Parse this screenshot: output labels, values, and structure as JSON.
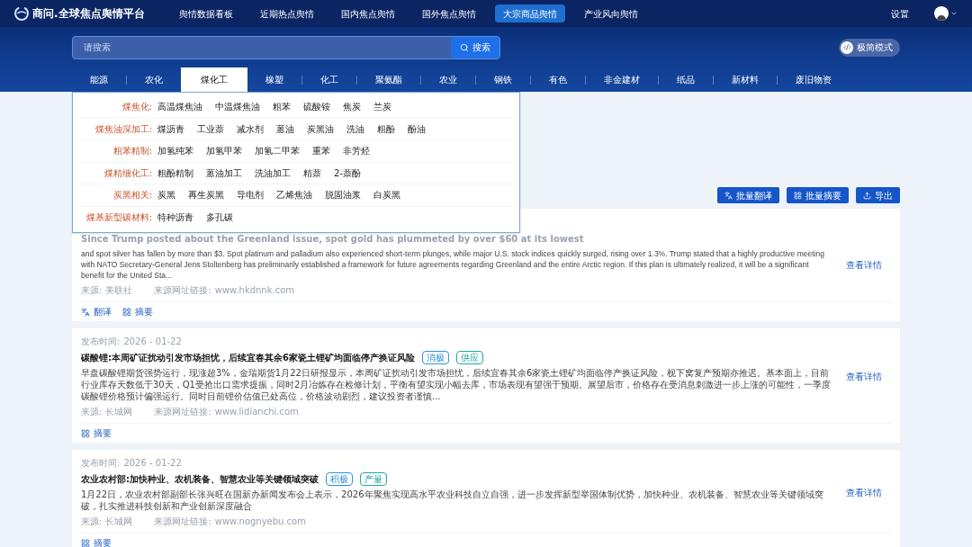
{
  "brand": {
    "name": "商问.全球焦点舆情平台"
  },
  "nav": [
    {
      "label": "舆情数据看板",
      "selected": false
    },
    {
      "label": "近期热点舆情",
      "selected": false
    },
    {
      "label": "国内焦点舆情",
      "selected": false
    },
    {
      "label": "国外焦点舆情",
      "selected": false
    },
    {
      "label": "大宗商品舆情",
      "selected": true
    },
    {
      "label": "产业风向舆情",
      "selected": false
    }
  ],
  "settings": "设置",
  "search": {
    "placeholder": "请搜索",
    "button": "搜索"
  },
  "mode_toggle": "极简模式",
  "categories": [
    {
      "label": "能源",
      "selected": false
    },
    {
      "label": "农化",
      "selected": false
    },
    {
      "label": "煤化工",
      "selected": true
    },
    {
      "label": "橡塑",
      "selected": false
    },
    {
      "label": "化工",
      "selected": false
    },
    {
      "label": "聚氨酯",
      "selected": false
    },
    {
      "label": "农业",
      "selected": false
    },
    {
      "label": "钢铁",
      "selected": false
    },
    {
      "label": "有色",
      "selected": false
    },
    {
      "label": "非金建材",
      "selected": false
    },
    {
      "label": "纸品",
      "selected": false
    },
    {
      "label": "新材料",
      "selected": false
    },
    {
      "label": "废旧物资",
      "selected": false
    }
  ],
  "dropdown": [
    {
      "label": "煤焦化:",
      "items": [
        "高温煤焦油",
        "中温煤焦油",
        "粗苯",
        "硫酸铵",
        "焦炭",
        "兰炭"
      ]
    },
    {
      "label": "煤焦油深加工:",
      "items": [
        "煤沥青",
        "工业萘",
        "减水剂",
        "蒽油",
        "炭黑油",
        "洗油",
        "粗酚",
        "酚油"
      ]
    },
    {
      "label": "粗苯精制:",
      "items": [
        "加氢纯苯",
        "加氢甲苯",
        "加氢二甲苯",
        "重苯",
        "非芳烃"
      ]
    },
    {
      "label": "煤精细化工:",
      "items": [
        "粗酚精制",
        "蒽油加工",
        "洗油加工",
        "精萘",
        "2-萘酚"
      ]
    },
    {
      "label": "炭黑相关:",
      "items": [
        "炭黑",
        "再生炭黑",
        "导电剂",
        "乙烯焦油",
        "脱固油浆",
        "白炭黑"
      ]
    },
    {
      "label": "煤基新型碳材料:",
      "items": [
        "特种沥青",
        "多孔碳"
      ]
    }
  ],
  "actions": [
    {
      "label": "批量翻译",
      "kind": "translate"
    },
    {
      "label": "批量摘要",
      "kind": "summary"
    },
    {
      "label": "导出",
      "kind": "export"
    }
  ],
  "articles": [
    {
      "title": "Since Trump posted about the Greenland issue, spot gold has plummeted by over $60 at its lowest",
      "body": "and spot silver has fallen by more than $3. Spot platinum and palladium also experienced short-term plunges, while major U.S. stock indices quickly surged, rising over 1.3%. Trump stated that a highly productive meeting with NATO Secretary-General Jens Stoltenberg has preliminarily established a framework for future agreements regarding Greenland and the entire Arctic region. If this plan is ultimately realized, it will be a significant benefit for the United Sta...",
      "source_label": "来源:",
      "source": "美联社",
      "link_label": "来源网址链接:",
      "link": "www.hkdnnk.com",
      "detail": "查看详情",
      "tools": [
        {
          "label": "翻译",
          "kind": "translate"
        },
        {
          "label": "摘要",
          "kind": "summary"
        }
      ]
    },
    {
      "date_label": "发布时间:",
      "date": "2026 - 01-22",
      "title": "碳酸锂:本周矿证扰动引发市场担忧，后续宜春其余6家瓷土锂矿均面临停产换证风险",
      "tags": [
        {
          "label": "消极",
          "color": "#2f8fd8"
        },
        {
          "label": "供应",
          "color": "#20a8a0"
        }
      ],
      "body": "早盘碳酸锂期货强势运行，现涨超3%，金瑞期货1月22日研报显示，本周矿证扰动引发市场担忧，后续宜春其余6家瓷土锂矿均面临停产换证风险，枧下窝复产预期亦推迟。基本面上，目前行业库存天数低于30天，Q1受抢出口需求提振，同时2月冶炼存在检修计划，平衡有望实现小幅去库，市场表现有望强于预期。展望后市，价格存在受消息刺激进一步上涨的可能性，一季度碳酸锂价格预计偏强运行。同时目前锂价估值已处高位，价格波动剧烈，建议投资者谨慎...",
      "source_label": "来源:",
      "source": "长城网",
      "link_label": "来源网址链接:",
      "link": "www.lidianchi.com",
      "detail": "查看详情",
      "tools": [
        {
          "label": "摘要",
          "kind": "summary"
        }
      ]
    },
    {
      "date_label": "发布时间:",
      "date": "2026 - 01-22",
      "title": "农业农村部:加快种业、农机装备、智慧农业等关键领域突破",
      "tags": [
        {
          "label": "积极",
          "color": "#2f8fd8"
        },
        {
          "label": "产量",
          "color": "#20a8a0"
        }
      ],
      "body": "1月22日，农业农村部副部长张兴旺在国新办新闻发布会上表示，2026年聚焦实现高水平农业科技自立自强，进一步发挥新型举国体制优势，加快种业、农机装备、智慧农业等关键领域突破，扎实推进科技创新和产业创新深度融合",
      "source_label": "来源:",
      "source": "长城网",
      "link_label": "来源网址链接:",
      "link": "www.nognyebu.com",
      "detail": "查看详情",
      "tools": [
        {
          "label": "摘要",
          "kind": "summary"
        }
      ]
    }
  ]
}
